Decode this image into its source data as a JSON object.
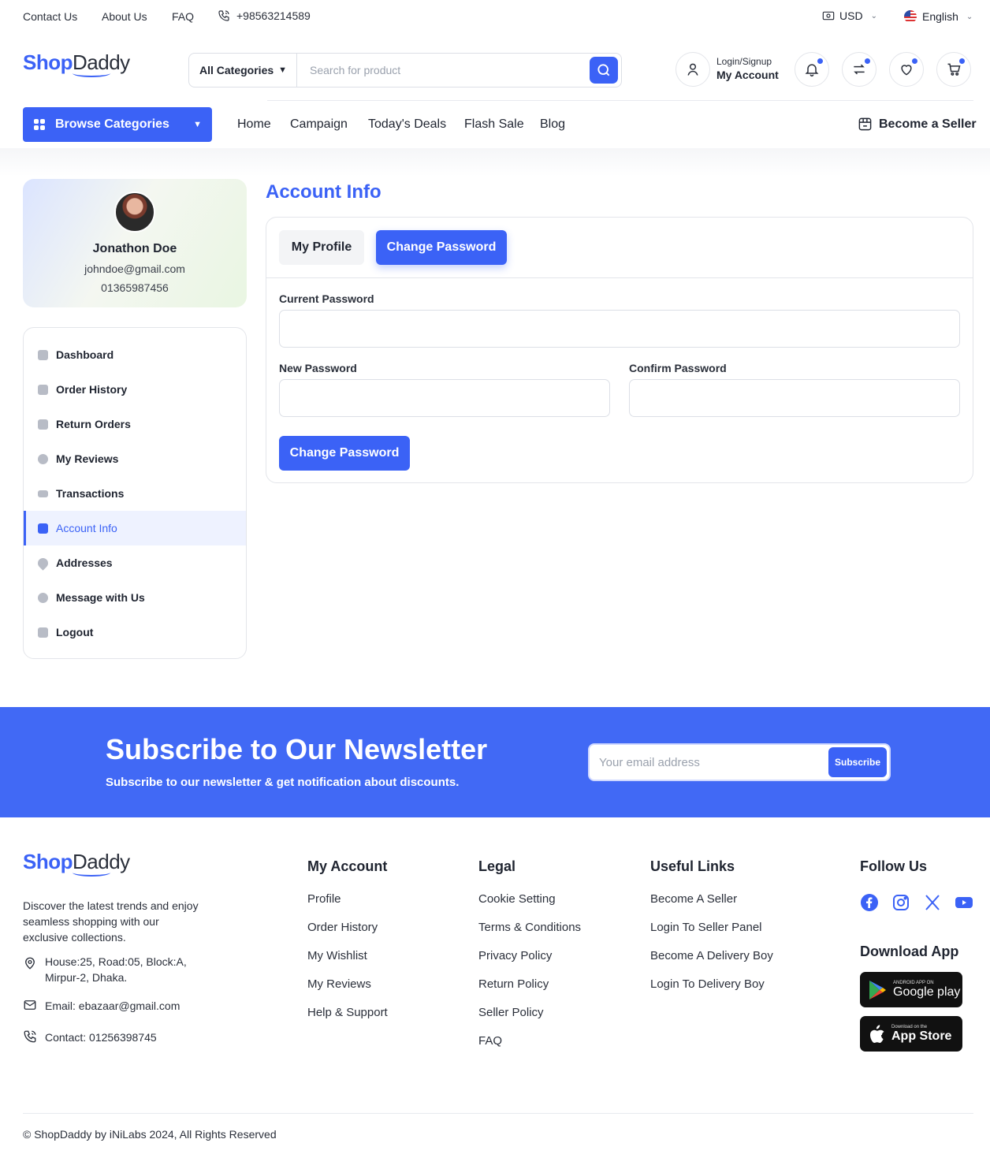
{
  "topbar": {
    "links": [
      "Contact Us",
      "About Us",
      "FAQ"
    ],
    "phone": "+98563214589",
    "currency": "USD",
    "language": "English"
  },
  "brand": {
    "part1": "Shop",
    "part2": "Daddy"
  },
  "search": {
    "category": "All Categories",
    "placeholder": "Search for product"
  },
  "account": {
    "line1": "Login/Signup",
    "line2": "My Account"
  },
  "nav": {
    "browse_label": "Browse Categories",
    "links": [
      "Home",
      "Campaign",
      "Today's Deals",
      "Flash Sale",
      "Blog"
    ],
    "seller": "Become a Seller"
  },
  "profile": {
    "name": "Jonathon Doe",
    "email": "johndoe@gmail.com",
    "phone": "01365987456"
  },
  "sidebar": {
    "items": [
      {
        "label": "Dashboard",
        "icon": "dashboard-icon"
      },
      {
        "label": "Order History",
        "icon": "order-history-icon"
      },
      {
        "label": "Return Orders",
        "icon": "return-orders-icon"
      },
      {
        "label": "My Reviews",
        "icon": "reviews-icon"
      },
      {
        "label": "Transactions",
        "icon": "transactions-icon"
      },
      {
        "label": "Account Info",
        "icon": "account-info-icon",
        "active": true
      },
      {
        "label": "Addresses",
        "icon": "location-icon"
      },
      {
        "label": "Message with Us",
        "icon": "message-icon"
      },
      {
        "label": "Logout",
        "icon": "logout-icon"
      }
    ]
  },
  "main": {
    "title": "Account Info",
    "tabs": [
      "My Profile",
      "Change Password"
    ],
    "fields": {
      "current": "Current Password",
      "new": "New Password",
      "confirm": "Confirm Password"
    },
    "submit": "Change Password"
  },
  "newsletter": {
    "title": "Subscribe to Our Newsletter",
    "subtitle": "Subscribe to our newsletter & get notification about discounts.",
    "placeholder": "Your email address",
    "button": "Subscribe"
  },
  "footer": {
    "description": "Discover the latest trends and enjoy seamless shopping with our exclusive collections.",
    "address": "House:25, Road:05, Block:A, Mirpur-2, Dhaka.",
    "email": "Email: ebazaar@gmail.com",
    "contact": "Contact: 01256398745",
    "columns": [
      {
        "title": "My Account",
        "links": [
          "Profile",
          "Order History",
          "My Wishlist",
          "My Reviews",
          "Help & Support"
        ]
      },
      {
        "title": "Legal",
        "links": [
          "Cookie Setting",
          "Terms & Conditions",
          "Privacy Policy",
          "Return Policy",
          "Seller Policy",
          "FAQ"
        ]
      },
      {
        "title": "Useful Links",
        "links": [
          "Become A Seller",
          "Login To Seller Panel",
          "Become A Delivery Boy",
          "Login To Delivery Boy"
        ]
      }
    ],
    "follow_title": "Follow Us",
    "download_title": "Download App",
    "google_small": "ANDROID APP ON",
    "google_big": "Google play",
    "apple_small": "Download on the",
    "apple_big": "App Store",
    "copyright": "© ShopDaddy by iNiLabs 2024, All Rights Reserved"
  },
  "colors": {
    "accent": "#3b62f6",
    "newsletter_bg": "#4169f5"
  }
}
